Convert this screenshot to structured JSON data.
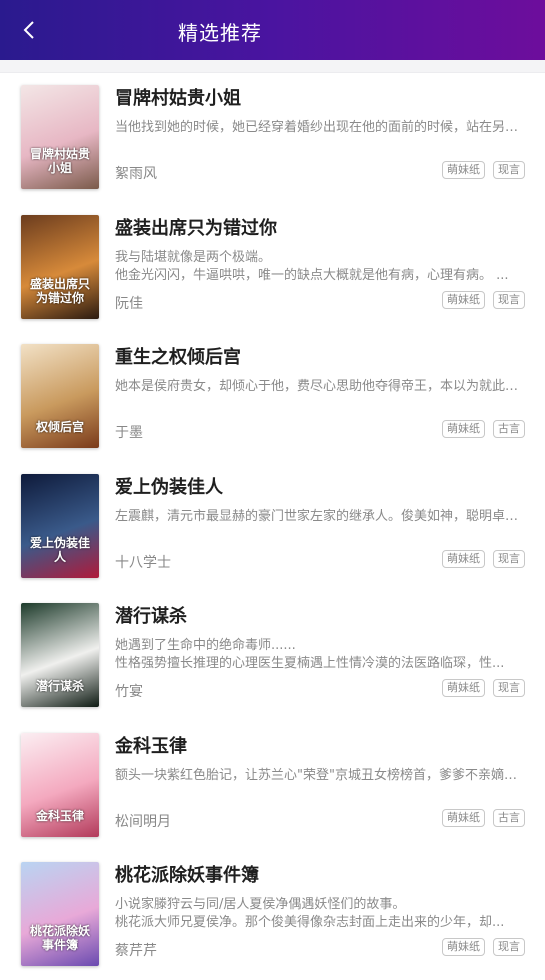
{
  "header": {
    "title": "精选推荐",
    "back_icon": "chevron-left-icon"
  },
  "books": [
    {
      "title": "冒牌村姑贵小姐",
      "desc": [
        "当他找到她的时候，她已经穿着婚纱出现在他的面前的时候，站在另一个男人的旁边，留下的也只有苦笑。没有你我一样能够过得很好..."
      ],
      "author": "絮雨风",
      "tags": [
        "萌妹纸",
        "现言"
      ],
      "cover_text": "冒牌村姑贵小姐",
      "cover_colors": [
        "#f3e6e6",
        "#e7b7c4",
        "#7a5a4a"
      ]
    },
    {
      "title": "盛装出席只为错过你",
      "desc": [
        "我与陆堪就像是两个极端。",
        "他金光闪闪，牛逼哄哄，唯一的缺点大概就是他有病，心理有病。 ..."
      ],
      "author": "阮佳",
      "tags": [
        "萌妹纸",
        "现言"
      ],
      "cover_text": "盛装出席只为错过你",
      "cover_colors": [
        "#6b3c1e",
        "#d78a3a",
        "#2b1a10"
      ]
    },
    {
      "title": "重生之权倾后宫",
      "desc": [
        "她本是侯府贵女，却倾心于他，费尽心思助他夺得帝王，本以为就此凤凰于飞，荣宠一生。 ..."
      ],
      "author": "于墨",
      "tags": [
        "萌妹纸",
        "古言"
      ],
      "cover_text": "权倾后宫",
      "cover_colors": [
        "#f2e1c6",
        "#c99a5e",
        "#7a3a1a"
      ]
    },
    {
      "title": "爱上伪装佳人",
      "desc": [
        "左震麒，清元市最显赫的豪门世家左家的继承人。俊美如神，聪明卓绝。 ..."
      ],
      "author": "十八学士",
      "tags": [
        "萌妹纸",
        "现言"
      ],
      "cover_text": "爱上伪装佳人",
      "cover_colors": [
        "#0e1a3a",
        "#3a5a8a",
        "#b01a3a"
      ]
    },
    {
      "title": "潜行谋杀",
      "desc": [
        "她遇到了生命中的绝命毒师......",
        "性格强势擅长推理的心理医生夏楠遇上性情冷漠的法医路临琛，性..."
      ],
      "author": "竹宴",
      "tags": [
        "萌妹纸",
        "现言"
      ],
      "cover_text": "潜行谋杀",
      "cover_colors": [
        "#1c3a2a",
        "#f0f0ee",
        "#0d1a12"
      ]
    },
    {
      "title": "金科玉律",
      "desc": [
        "额头一块紫红色胎记，让苏兰心\"荣登\"京城丑女榜榜首，爹爹不亲嫡母不爱，妥妥就是被炮灰的节奏。 ..."
      ],
      "author": "松间明月",
      "tags": [
        "萌妹纸",
        "古言"
      ],
      "cover_text": "金科玉律",
      "cover_colors": [
        "#fbeef2",
        "#f4a9bf",
        "#b23a5a"
      ]
    },
    {
      "title": "桃花派除妖事件簿",
      "desc": [
        "小说家滕狩云与同/居人夏侯净偶遇妖怪们的故事。",
        "桃花派大师兄夏侯净。那个俊美得像杂志封面上走出来的少年，却..."
      ],
      "author": "蔡芹芹",
      "tags": [
        "萌妹纸",
        "现言"
      ],
      "cover_text": "桃花派除妖事件簿",
      "cover_colors": [
        "#b9d4f2",
        "#e8a9d8",
        "#6a4ab0"
      ]
    }
  ]
}
